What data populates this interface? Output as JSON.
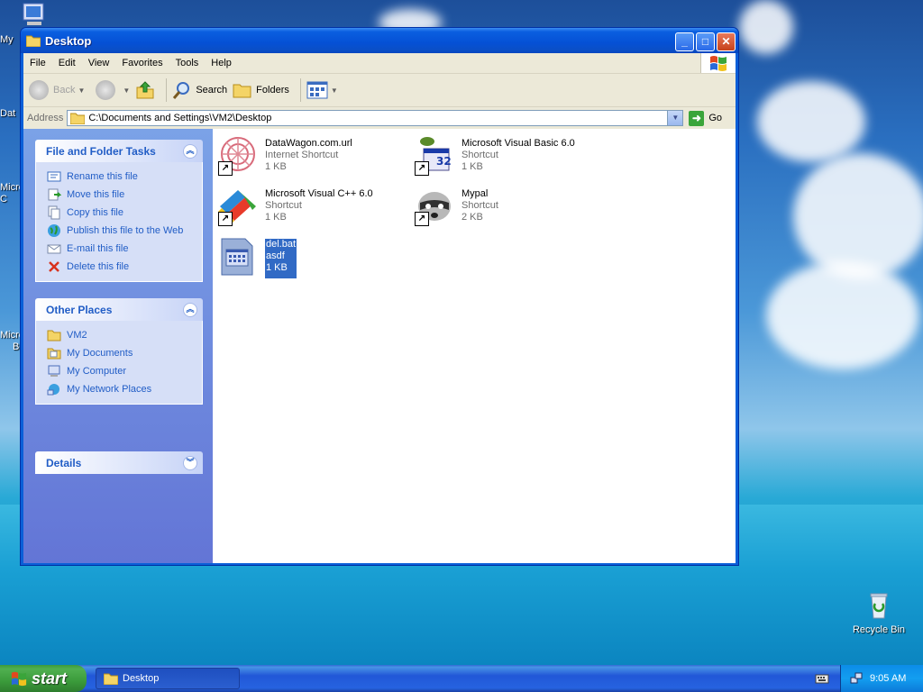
{
  "desktop": {
    "left_labels": [
      "My",
      "Dat",
      "Micro",
      "C",
      "Micro",
      "B"
    ],
    "recycle_bin_label": "Recycle Bin"
  },
  "window": {
    "title": "Desktop",
    "menu": [
      "File",
      "Edit",
      "View",
      "Favorites",
      "Tools",
      "Help"
    ],
    "toolbar": {
      "back_label": "Back",
      "search_label": "Search",
      "folders_label": "Folders"
    },
    "address": {
      "label": "Address",
      "value": "C:\\Documents and Settings\\VM2\\Desktop",
      "go_label": "Go"
    }
  },
  "tasks_panel": {
    "title": "File and Folder Tasks",
    "items": [
      "Rename this file",
      "Move this file",
      "Copy this file",
      "Publish this file to the Web",
      "E-mail this file",
      "Delete this file"
    ]
  },
  "places_panel": {
    "title": "Other Places",
    "items": [
      "VM2",
      "My Documents",
      "My Computer",
      "My Network Places"
    ]
  },
  "details_panel": {
    "title": "Details"
  },
  "files": [
    {
      "name": "DataWagon.com.url",
      "type": "Internet Shortcut",
      "size": "1 KB"
    },
    {
      "name": "Microsoft Visual Basic 6.0",
      "type": "Shortcut",
      "size": "1 KB"
    },
    {
      "name": "Microsoft Visual C++ 6.0",
      "type": "Shortcut",
      "size": "1 KB"
    },
    {
      "name": "Mypal",
      "type": "Shortcut",
      "size": "2 KB"
    },
    {
      "name": "del.bat",
      "type": "asdf",
      "size": "1 KB",
      "selected": true
    }
  ],
  "taskbar": {
    "start_label": "start",
    "task_label": "Desktop",
    "clock": "9:05 AM"
  }
}
